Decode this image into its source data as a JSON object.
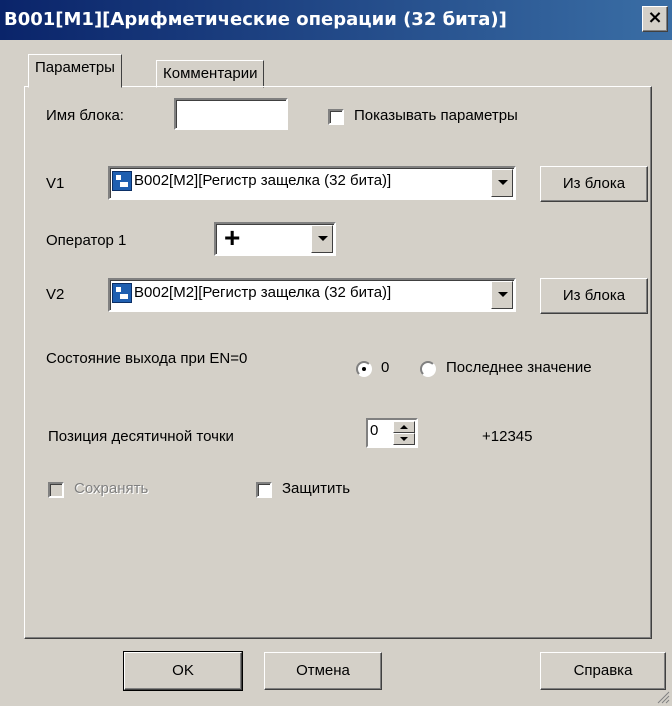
{
  "window": {
    "title": "B001[M1][Арифметические операции (32 бита)]",
    "close_glyph": "×"
  },
  "tabs": [
    {
      "label": "Параметры",
      "active": true
    },
    {
      "label": "Комментарии",
      "active": false
    }
  ],
  "params": {
    "block_name_label": "Имя блока:",
    "block_name_value": "",
    "show_params_label": "Показывать параметры",
    "show_params_checked": false,
    "v1_label": "V1",
    "v1_value": "B002[M2][Регистр защелка (32 бита)]",
    "v1_icon": "block-icon",
    "from_block_label": "Из блока",
    "operator_label": "Оператор 1",
    "operator_value": "+",
    "v2_label": "V2",
    "v2_value": "B002[M2][Регистр защелка (32 бита)]",
    "output_state_label": "Состояние выхода при EN=0",
    "radio_zero_label": "0",
    "radio_last_label": "Последнее значение",
    "selected_output_state": "0",
    "decimal_pos_label": "Позиция десятичной точки",
    "decimal_pos_value": "0",
    "decimal_preview": "+12345",
    "save_label": "Сохранять",
    "save_checked": false,
    "save_disabled": true,
    "protect_label": "Защитить",
    "protect_checked": false
  },
  "buttons": {
    "ok": "OK",
    "cancel": "Отмена",
    "help": "Справка"
  },
  "colors": {
    "title_bar": "#0a246a",
    "face": "#d4d0c8",
    "disabled_text": "#808080"
  }
}
